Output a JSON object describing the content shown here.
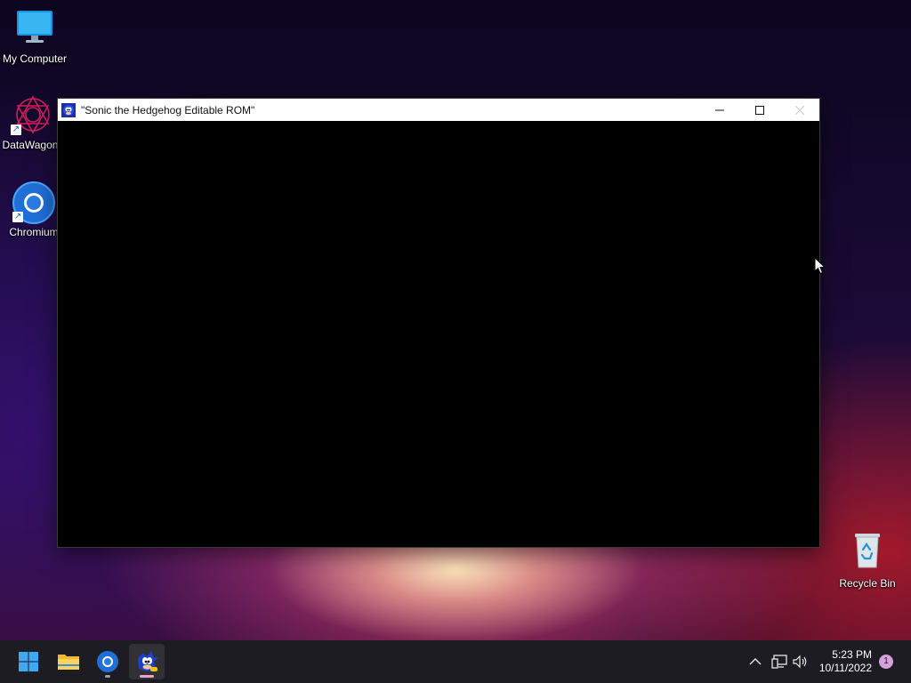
{
  "desktop": {
    "icons": [
      {
        "label": "My Computer"
      },
      {
        "label": "DataWagon"
      },
      {
        "label": "Chromium"
      },
      {
        "label": "Recycle Bin"
      }
    ]
  },
  "window": {
    "title": "\"Sonic the Hedgehog Editable ROM\"",
    "icon": "sonic-icon",
    "controls": {
      "minimize": "minimize-icon",
      "maximize": "maximize-icon",
      "close": "close-icon"
    }
  },
  "taskbar": {
    "items": [
      {
        "name": "Start",
        "icon": "windows-logo-icon"
      },
      {
        "name": "File Explorer",
        "icon": "folder-icon"
      },
      {
        "name": "Chromium",
        "icon": "chromium-icon"
      },
      {
        "name": "Sonic the Hedgehog Editable ROM",
        "icon": "sonic-icon"
      }
    ],
    "tray": {
      "chevron": "chevron-up-icon",
      "network": "network-icon",
      "volume": "volume-icon",
      "time": "5:23 PM",
      "date": "10/11/2022",
      "notification_count": "1"
    }
  },
  "colors": {
    "accent": "#0078d4",
    "active_indicator": "#e8a4c8",
    "notification_badge": "#d8a0d8"
  }
}
